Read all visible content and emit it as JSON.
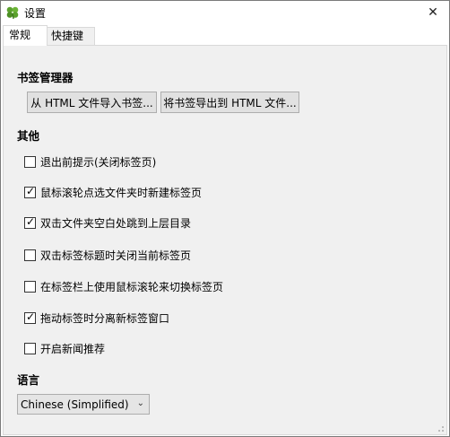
{
  "window": {
    "title": "设置",
    "close_symbol": "✕"
  },
  "tabs": [
    {
      "label": "常规",
      "active": true
    },
    {
      "label": "快捷键",
      "active": false
    }
  ],
  "bookmarks": {
    "heading": "书签管理器",
    "import_label": "从 HTML 文件导入书签...",
    "export_label": "将书签导出到 HTML 文件..."
  },
  "other": {
    "heading": "其他",
    "options": [
      {
        "label": "退出前提示(关闭标签页)",
        "checked": false
      },
      {
        "label": "鼠标滚轮点选文件夹时新建标签页",
        "checked": true
      },
      {
        "label": "双击文件夹空白处跳到上层目录",
        "checked": true
      },
      {
        "label": "双击标签标题时关闭当前标签页",
        "checked": false
      },
      {
        "label": "在标签栏上使用鼠标滚轮来切换标签页",
        "checked": false
      },
      {
        "label": "拖动标签时分离新标签窗口",
        "checked": true
      },
      {
        "label": "开启新闻推荐",
        "checked": false
      }
    ]
  },
  "language": {
    "heading": "语言",
    "selected": "Chinese (Simplified)"
  },
  "icons": {
    "app": "clover-icon",
    "close": "close-icon",
    "dropdown": "chevron-down-icon",
    "check": "checkmark-icon"
  },
  "colors": {
    "panel_bg": "#f0f0f0",
    "button_bg": "#e1e1e1",
    "border": "#adadad",
    "clover_green": "#5aa02c"
  }
}
